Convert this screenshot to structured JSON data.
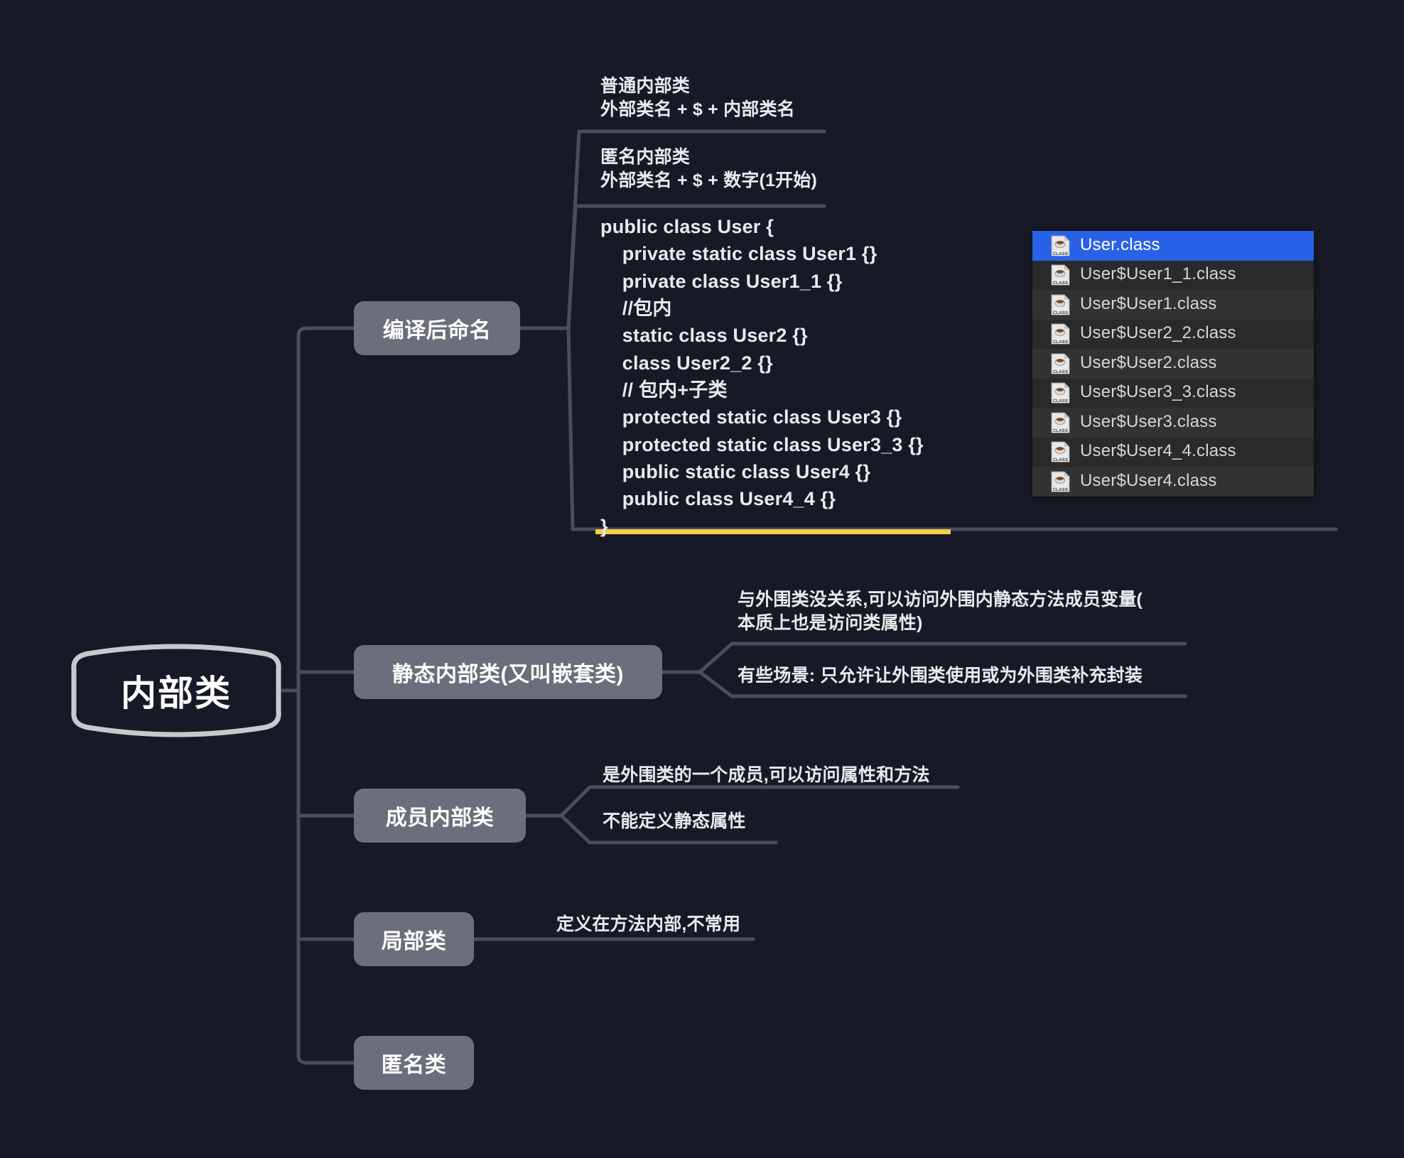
{
  "canvas": {
    "background": "#171a26",
    "node_fill": "#6b6e7b",
    "wire_color": "#4a4e5c",
    "highlight_color": "#f2d049",
    "selection_color": "#2962e8"
  },
  "root": {
    "label": "内部类"
  },
  "branches": [
    {
      "id": "compiled-naming",
      "label": "编译后命名"
    },
    {
      "id": "static-inner-class",
      "label": "静态内部类(又叫嵌套类)"
    },
    {
      "id": "member-inner-class",
      "label": "成员内部类"
    },
    {
      "id": "local-class",
      "label": "局部类"
    },
    {
      "id": "anonymous-class",
      "label": "匿名类"
    }
  ],
  "notes": {
    "normal_inner_class": "普通内部类\n外部类名 + $ + 内部类名",
    "anonymous_inner_class": "匿名内部类\n外部类名 + $ + 数字(1开始)",
    "static_note_1": "与外围类没关系,可以访问外围内静态方法成员变量(\n本质上也是访问类属性)",
    "static_note_2": "有些场景: 只允许让外围类使用或为外围类补充封装",
    "member_note_1": "是外围类的一个成员,可以访问属性和方法",
    "member_note_2": "不能定义静态属性",
    "local_note_1": "定义在方法内部,不常用"
  },
  "code_block": {
    "text": "public class User {\n    private static class User1 {}\n    private class User1_1 {}\n    //包内\n    static class User2 {}\n    class User2_2 {}\n    // 包内+子类\n    protected static class User3 {}\n    protected static class User3_3 {}\n    public static class User4 {}\n    public class User4_4 {}\n}"
  },
  "file_list": {
    "files": [
      {
        "name": "User.class",
        "selected": true
      },
      {
        "name": "User$User1_1.class",
        "selected": false
      },
      {
        "name": "User$User1.class",
        "selected": false
      },
      {
        "name": "User$User2_2.class",
        "selected": false
      },
      {
        "name": "User$User2.class",
        "selected": false
      },
      {
        "name": "User$User3_3.class",
        "selected": false
      },
      {
        "name": "User$User3.class",
        "selected": false
      },
      {
        "name": "User$User4_4.class",
        "selected": false
      },
      {
        "name": "User$User4.class",
        "selected": false
      }
    ],
    "icon": "java-class-file-icon"
  }
}
